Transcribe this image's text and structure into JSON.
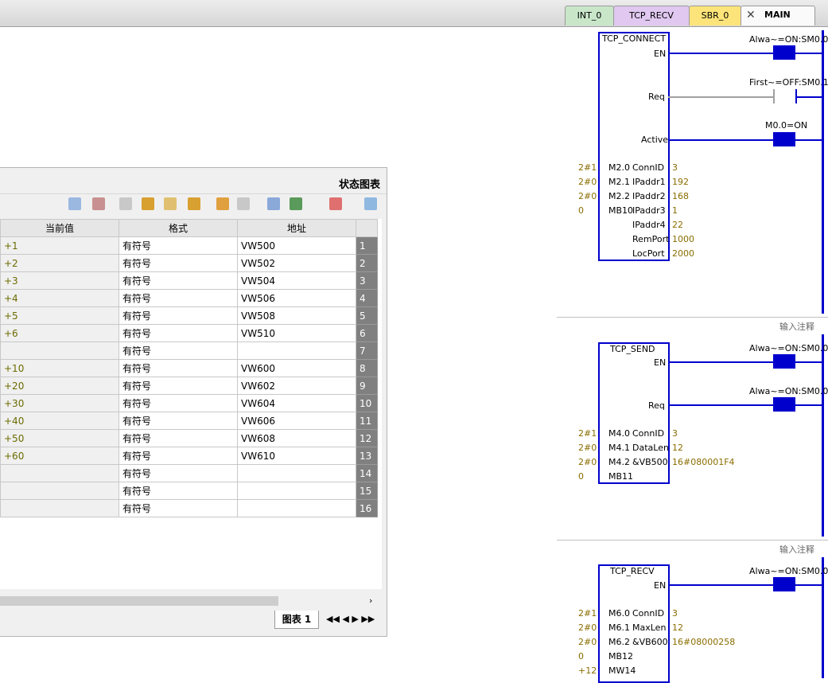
{
  "tabs": {
    "main": "MAIN",
    "sbr": "SBR_0",
    "recv": "TCP_RECV",
    "int": "INT_0"
  },
  "chart": {
    "title": "状态图表",
    "headers": {
      "address": "地址",
      "format": "格式",
      "current": "当前值"
    },
    "rows": [
      {
        "n": "1",
        "addr": "VW500",
        "fmt": "有符号",
        "val": "+1"
      },
      {
        "n": "2",
        "addr": "VW502",
        "fmt": "有符号",
        "val": "+2"
      },
      {
        "n": "3",
        "addr": "VW504",
        "fmt": "有符号",
        "val": "+3"
      },
      {
        "n": "4",
        "addr": "VW506",
        "fmt": "有符号",
        "val": "+4"
      },
      {
        "n": "5",
        "addr": "VW508",
        "fmt": "有符号",
        "val": "+5"
      },
      {
        "n": "6",
        "addr": "VW510",
        "fmt": "有符号",
        "val": "+6"
      },
      {
        "n": "7",
        "addr": "",
        "fmt": "有符号",
        "val": ""
      },
      {
        "n": "8",
        "addr": "VW600",
        "fmt": "有符号",
        "val": "+10"
      },
      {
        "n": "9",
        "addr": "VW602",
        "fmt": "有符号",
        "val": "+20"
      },
      {
        "n": "10",
        "addr": "VW604",
        "fmt": "有符号",
        "val": "+30"
      },
      {
        "n": "11",
        "addr": "VW606",
        "fmt": "有符号",
        "val": "+40"
      },
      {
        "n": "12",
        "addr": "VW608",
        "fmt": "有符号",
        "val": "+50"
      },
      {
        "n": "13",
        "addr": "VW610",
        "fmt": "有符号",
        "val": "+60"
      },
      {
        "n": "14",
        "addr": "",
        "fmt": "有符号",
        "val": ""
      },
      {
        "n": "15",
        "addr": "",
        "fmt": "有符号",
        "val": ""
      },
      {
        "n": "16",
        "addr": "",
        "fmt": "有符号",
        "val": ""
      }
    ],
    "sheet_tab": "图表 1"
  },
  "ladder": {
    "comment": "输入注释",
    "connect": {
      "name": "TCP_CONNECT",
      "en": "EN",
      "req": "Req",
      "active": "Active",
      "c1": "Alwa~=ON:SM0.0",
      "c2": "First~=OFF:SM0.1",
      "c3": "M0.0=ON",
      "pins": [
        {
          "pin": "ConnID",
          "val": "3",
          "out": "M2.0",
          "res": "2#1"
        },
        {
          "pin": "IPaddr1",
          "val": "192",
          "out": "M2.1",
          "res": "2#0"
        },
        {
          "pin": "IPaddr2",
          "val": "168",
          "out": "M2.2",
          "res": "2#0"
        },
        {
          "pin": "IPaddr3",
          "val": "1",
          "out": "MB10",
          "res": "0"
        },
        {
          "pin": "IPaddr4",
          "val": "22",
          "out": "",
          "res": ""
        },
        {
          "pin": "RemPort",
          "val": "1000",
          "out": "",
          "res": ""
        },
        {
          "pin": "LocPort",
          "val": "2000",
          "out": "",
          "res": ""
        }
      ]
    },
    "send": {
      "name": "TCP_SEND",
      "en": "EN",
      "req": "Req",
      "c1": "Alwa~=ON:SM0.0",
      "c2": "Alwa~=ON:SM0.0",
      "pins": [
        {
          "pin": "ConnID",
          "val": "3",
          "out": "M4.0",
          "res": "2#1"
        },
        {
          "pin": "DataLen",
          "val": "12",
          "out": "M4.1",
          "res": "2#0"
        },
        {
          "pin": "&VB500",
          "val": "16#080001F4",
          "out": "M4.2",
          "res": "2#0"
        },
        {
          "pin": "",
          "val": "",
          "out": "MB11",
          "res": "0"
        }
      ]
    },
    "recv": {
      "name": "TCP_RECV",
      "en": "EN",
      "c1": "Alwa~=ON:SM0.0",
      "pins": [
        {
          "pin": "ConnID",
          "val": "3",
          "out": "M6.0",
          "res": "2#1"
        },
        {
          "pin": "MaxLen",
          "val": "12",
          "out": "M6.1",
          "res": "2#0"
        },
        {
          "pin": "&VB600",
          "val": "16#08000258",
          "out": "M6.2",
          "res": "2#0"
        },
        {
          "pin": "",
          "val": "",
          "out": "MB12",
          "res": "0"
        },
        {
          "pin": "",
          "val": "",
          "out": "MW14",
          "res": "+12"
        }
      ]
    }
  }
}
